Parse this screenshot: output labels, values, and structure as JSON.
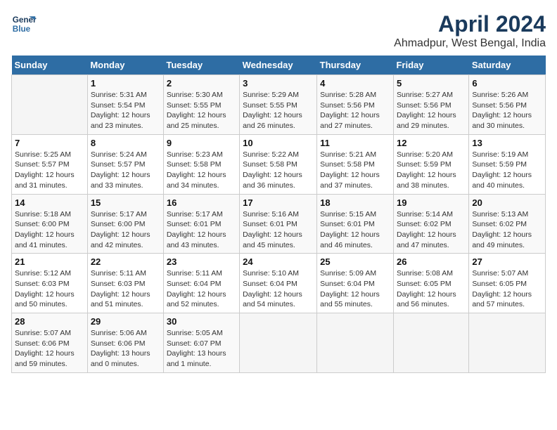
{
  "header": {
    "logo_line1": "General",
    "logo_line2": "Blue",
    "title": "April 2024",
    "subtitle": "Ahmadpur, West Bengal, India"
  },
  "calendar": {
    "days_of_week": [
      "Sunday",
      "Monday",
      "Tuesday",
      "Wednesday",
      "Thursday",
      "Friday",
      "Saturday"
    ],
    "weeks": [
      [
        {
          "num": "",
          "info": ""
        },
        {
          "num": "1",
          "info": "Sunrise: 5:31 AM\nSunset: 5:54 PM\nDaylight: 12 hours\nand 23 minutes."
        },
        {
          "num": "2",
          "info": "Sunrise: 5:30 AM\nSunset: 5:55 PM\nDaylight: 12 hours\nand 25 minutes."
        },
        {
          "num": "3",
          "info": "Sunrise: 5:29 AM\nSunset: 5:55 PM\nDaylight: 12 hours\nand 26 minutes."
        },
        {
          "num": "4",
          "info": "Sunrise: 5:28 AM\nSunset: 5:56 PM\nDaylight: 12 hours\nand 27 minutes."
        },
        {
          "num": "5",
          "info": "Sunrise: 5:27 AM\nSunset: 5:56 PM\nDaylight: 12 hours\nand 29 minutes."
        },
        {
          "num": "6",
          "info": "Sunrise: 5:26 AM\nSunset: 5:56 PM\nDaylight: 12 hours\nand 30 minutes."
        }
      ],
      [
        {
          "num": "7",
          "info": "Sunrise: 5:25 AM\nSunset: 5:57 PM\nDaylight: 12 hours\nand 31 minutes."
        },
        {
          "num": "8",
          "info": "Sunrise: 5:24 AM\nSunset: 5:57 PM\nDaylight: 12 hours\nand 33 minutes."
        },
        {
          "num": "9",
          "info": "Sunrise: 5:23 AM\nSunset: 5:58 PM\nDaylight: 12 hours\nand 34 minutes."
        },
        {
          "num": "10",
          "info": "Sunrise: 5:22 AM\nSunset: 5:58 PM\nDaylight: 12 hours\nand 36 minutes."
        },
        {
          "num": "11",
          "info": "Sunrise: 5:21 AM\nSunset: 5:58 PM\nDaylight: 12 hours\nand 37 minutes."
        },
        {
          "num": "12",
          "info": "Sunrise: 5:20 AM\nSunset: 5:59 PM\nDaylight: 12 hours\nand 38 minutes."
        },
        {
          "num": "13",
          "info": "Sunrise: 5:19 AM\nSunset: 5:59 PM\nDaylight: 12 hours\nand 40 minutes."
        }
      ],
      [
        {
          "num": "14",
          "info": "Sunrise: 5:18 AM\nSunset: 6:00 PM\nDaylight: 12 hours\nand 41 minutes."
        },
        {
          "num": "15",
          "info": "Sunrise: 5:17 AM\nSunset: 6:00 PM\nDaylight: 12 hours\nand 42 minutes."
        },
        {
          "num": "16",
          "info": "Sunrise: 5:17 AM\nSunset: 6:01 PM\nDaylight: 12 hours\nand 43 minutes."
        },
        {
          "num": "17",
          "info": "Sunrise: 5:16 AM\nSunset: 6:01 PM\nDaylight: 12 hours\nand 45 minutes."
        },
        {
          "num": "18",
          "info": "Sunrise: 5:15 AM\nSunset: 6:01 PM\nDaylight: 12 hours\nand 46 minutes."
        },
        {
          "num": "19",
          "info": "Sunrise: 5:14 AM\nSunset: 6:02 PM\nDaylight: 12 hours\nand 47 minutes."
        },
        {
          "num": "20",
          "info": "Sunrise: 5:13 AM\nSunset: 6:02 PM\nDaylight: 12 hours\nand 49 minutes."
        }
      ],
      [
        {
          "num": "21",
          "info": "Sunrise: 5:12 AM\nSunset: 6:03 PM\nDaylight: 12 hours\nand 50 minutes."
        },
        {
          "num": "22",
          "info": "Sunrise: 5:11 AM\nSunset: 6:03 PM\nDaylight: 12 hours\nand 51 minutes."
        },
        {
          "num": "23",
          "info": "Sunrise: 5:11 AM\nSunset: 6:04 PM\nDaylight: 12 hours\nand 52 minutes."
        },
        {
          "num": "24",
          "info": "Sunrise: 5:10 AM\nSunset: 6:04 PM\nDaylight: 12 hours\nand 54 minutes."
        },
        {
          "num": "25",
          "info": "Sunrise: 5:09 AM\nSunset: 6:04 PM\nDaylight: 12 hours\nand 55 minutes."
        },
        {
          "num": "26",
          "info": "Sunrise: 5:08 AM\nSunset: 6:05 PM\nDaylight: 12 hours\nand 56 minutes."
        },
        {
          "num": "27",
          "info": "Sunrise: 5:07 AM\nSunset: 6:05 PM\nDaylight: 12 hours\nand 57 minutes."
        }
      ],
      [
        {
          "num": "28",
          "info": "Sunrise: 5:07 AM\nSunset: 6:06 PM\nDaylight: 12 hours\nand 59 minutes."
        },
        {
          "num": "29",
          "info": "Sunrise: 5:06 AM\nSunset: 6:06 PM\nDaylight: 13 hours\nand 0 minutes."
        },
        {
          "num": "30",
          "info": "Sunrise: 5:05 AM\nSunset: 6:07 PM\nDaylight: 13 hours\nand 1 minute."
        },
        {
          "num": "",
          "info": ""
        },
        {
          "num": "",
          "info": ""
        },
        {
          "num": "",
          "info": ""
        },
        {
          "num": "",
          "info": ""
        }
      ]
    ]
  }
}
